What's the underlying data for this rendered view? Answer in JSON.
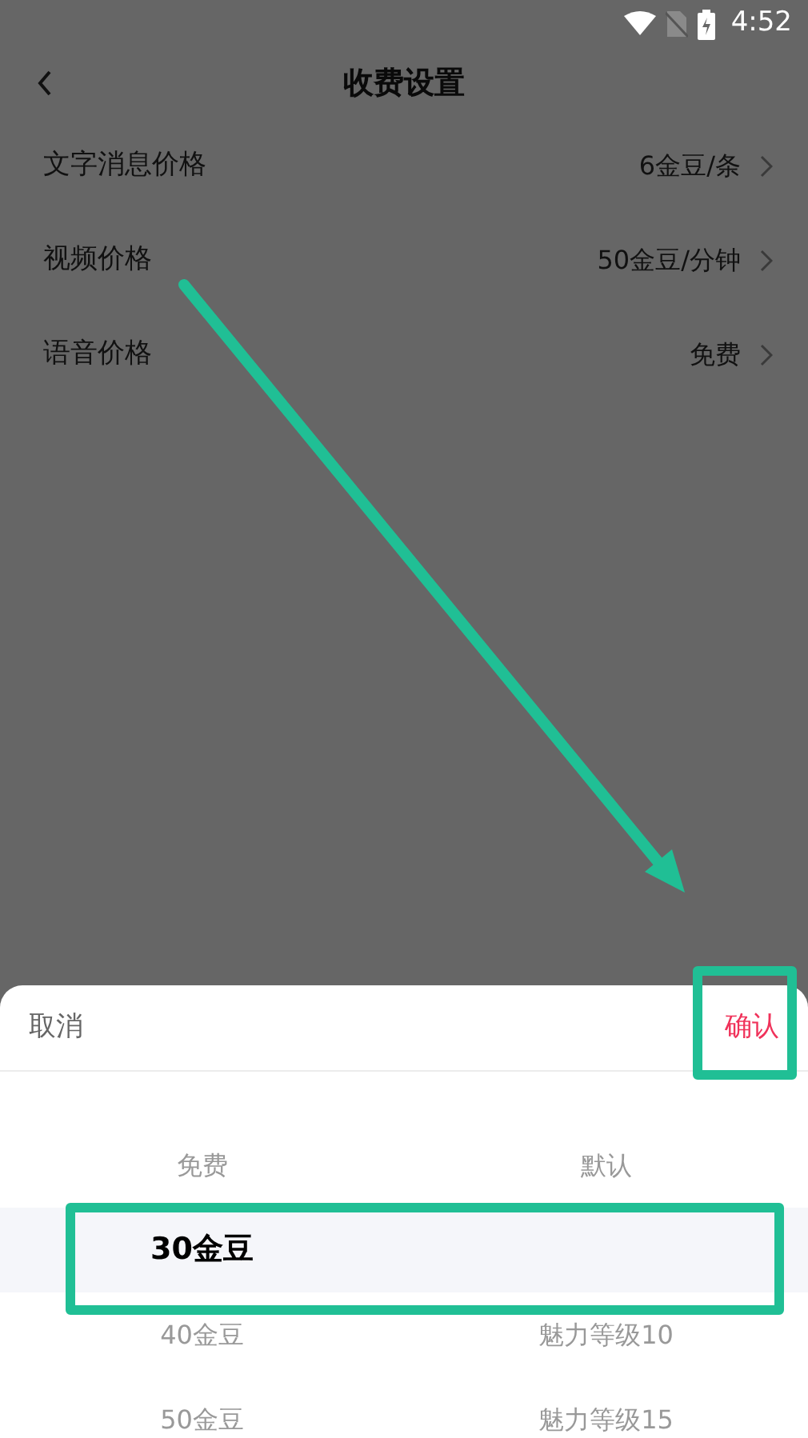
{
  "status_bar": {
    "time": "4:52"
  },
  "header": {
    "title": "收费设置"
  },
  "settings": [
    {
      "label": "文字消息价格",
      "value": "6金豆/条"
    },
    {
      "label": "视频价格",
      "value": "50金豆/分钟"
    },
    {
      "label": "语音价格",
      "value": "免费"
    }
  ],
  "picker": {
    "cancel": "取消",
    "confirm": "确认",
    "rows": [
      {
        "left": "免费",
        "right": "默认",
        "selected": false
      },
      {
        "left": "30金豆",
        "selected": true
      },
      {
        "left": "40金豆",
        "right": "魅力等级10",
        "selected": false
      },
      {
        "left": "50金豆",
        "right": "魅力等级15",
        "selected": false
      }
    ]
  },
  "annotations": [
    {
      "kind": "arrow"
    },
    {
      "kind": "box"
    },
    {
      "kind": "box"
    }
  ]
}
